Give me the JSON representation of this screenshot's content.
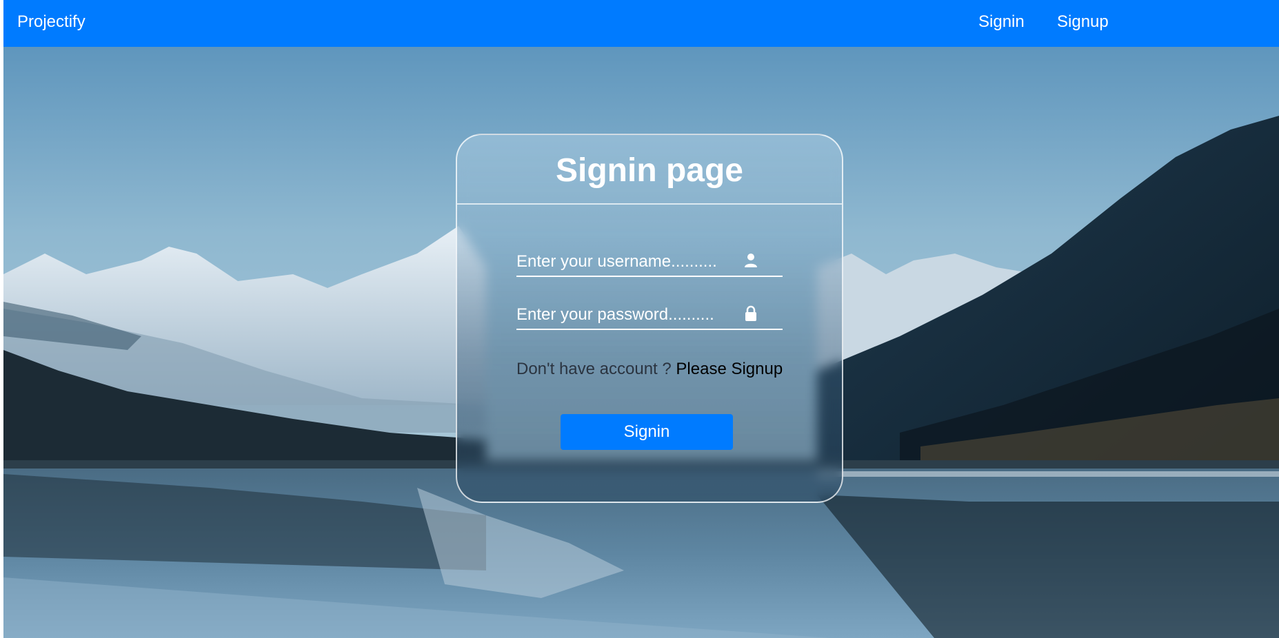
{
  "navbar": {
    "brand": "Projectify",
    "links": [
      {
        "label": "Signin"
      },
      {
        "label": "Signup"
      }
    ],
    "color": "#007bff"
  },
  "form": {
    "title": "Signin page",
    "username_placeholder": "Enter your username..........",
    "password_placeholder": "Enter your password..........",
    "username_icon": "user-icon",
    "password_icon": "lock-icon",
    "account_prompt": "Don't have account ?",
    "signup_link": "Please Signup",
    "submit_label": "Signin"
  },
  "background": {
    "description_icon": "mountain-lake-photo"
  }
}
